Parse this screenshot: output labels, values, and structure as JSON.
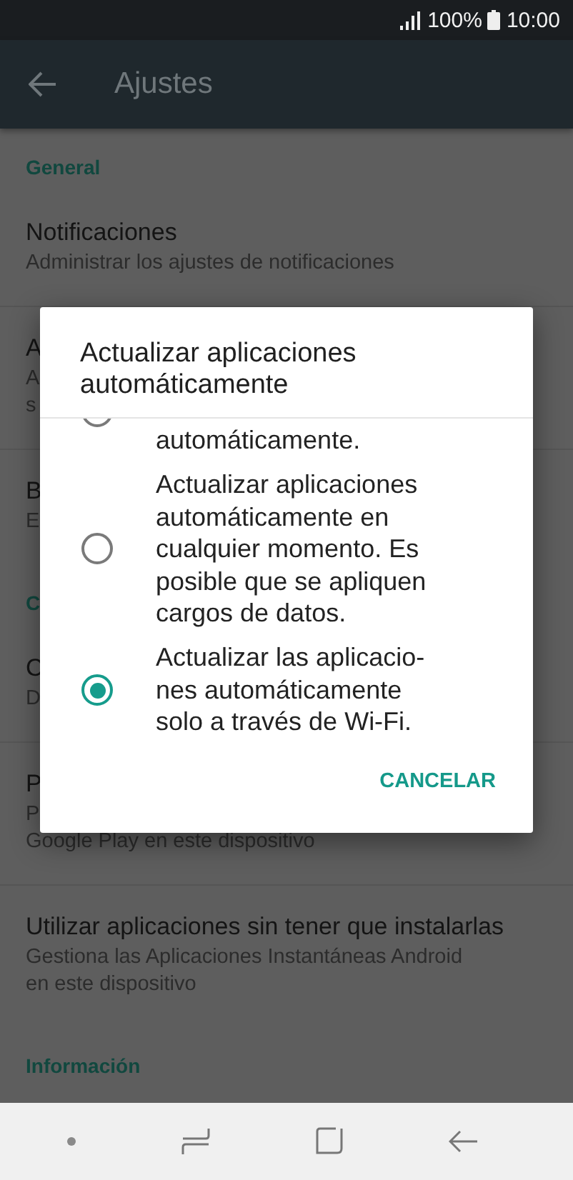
{
  "status_bar": {
    "battery": "100%",
    "time": "10:00"
  },
  "app_bar": {
    "title": "Ajustes"
  },
  "settings": [
    {
      "kind": "section",
      "label": "General"
    },
    {
      "kind": "item",
      "title": "Notificaciones",
      "subtitle_lines": [
        "Administrar los ajustes de notificaciones"
      ]
    },
    {
      "kind": "item",
      "title": "A",
      "subtitle_lines": [
        "A",
        "s"
      ]
    },
    {
      "kind": "item",
      "title": "B",
      "subtitle_lines": [
        "E"
      ]
    },
    {
      "kind": "section",
      "label": "C"
    },
    {
      "kind": "item",
      "title": "C",
      "subtitle_lines": [
        "D"
      ]
    },
    {
      "kind": "item",
      "title": "P",
      "subtitle_lines": [
        "P",
        "Google Play en este dispositivo"
      ]
    },
    {
      "kind": "item",
      "title": "Utilizar aplicaciones sin tener que instalarlas",
      "subtitle_lines": [
        "Gestiona las Aplicaciones Instantáneas Android",
        "en este dispositivo"
      ]
    },
    {
      "kind": "section",
      "label": "Información"
    }
  ],
  "dialog": {
    "title": "Actualizar aplicaciones automáticamente",
    "options": [
      {
        "label": "automáticamente.",
        "selected": false
      },
      {
        "label": "Actualizar aplicaciones\nautomáticamente en\ncualquier momento. Es\nposible que se apliquen\ncargos de datos.",
        "selected": false
      },
      {
        "label": "Actualizar las aplicacio-\nnes automáticamente\nsolo a través de Wi-Fi.",
        "selected": true
      }
    ],
    "buttons": [
      "CANCELAR"
    ]
  }
}
